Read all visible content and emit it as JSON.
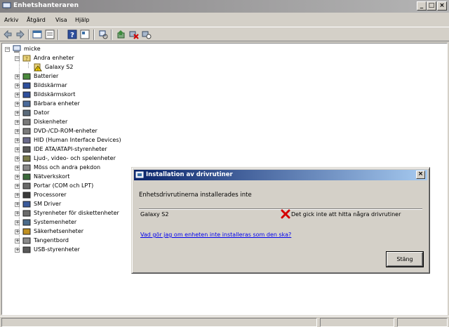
{
  "window": {
    "title": "Enhetshanteraren",
    "minimize": "_",
    "maximize": "□",
    "close": "×"
  },
  "menu": [
    "Arkiv",
    "Åtgärd",
    "Visa",
    "Hjälp"
  ],
  "toolbar": {
    "icons": [
      "back-icon",
      "forward-icon",
      "properties-icon",
      "refresh-icon",
      "help-icon",
      "properties-view-icon",
      "scan-hardware-icon",
      "update-driver-icon",
      "uninstall-icon",
      "disable-icon"
    ]
  },
  "tree": {
    "root": "micke",
    "other_devices": "Andra enheter",
    "other_devices_child": "Galaxy S2",
    "categories": [
      "Batterier",
      "Bildskärmar",
      "Bildskärmskort",
      "Bärbara enheter",
      "Dator",
      "Diskenheter",
      "DVD-/CD-ROM-enheter",
      "HID (Human Interface Devices)",
      "IDE ATA/ATAPI-styrenheter",
      "Ljud-, video- och spelenheter",
      "Möss och andra pekdon",
      "Nätverkskort",
      "Portar (COM och LPT)",
      "Processorer",
      "SM Driver",
      "Styrenheter för diskettenheter",
      "Systemenheter",
      "Säkerhetsenheter",
      "Tangentbord",
      "USB-styrenheter"
    ],
    "expander_collapsed": "+",
    "expander_expanded": "−"
  },
  "dialog": {
    "title": "Installation av drivrutiner",
    "close": "×",
    "heading": "Enhetsdrivrutinerna installerades inte",
    "device": "Galaxy S2",
    "status": "Det gick inte att hitta några drivrutiner",
    "link": "Vad gör jag om enheten inte installeras som den ska?",
    "button": "Stäng"
  },
  "colors": {
    "dialog_title": "#0a246a",
    "link": "#0000ee",
    "error": "#d40000"
  }
}
